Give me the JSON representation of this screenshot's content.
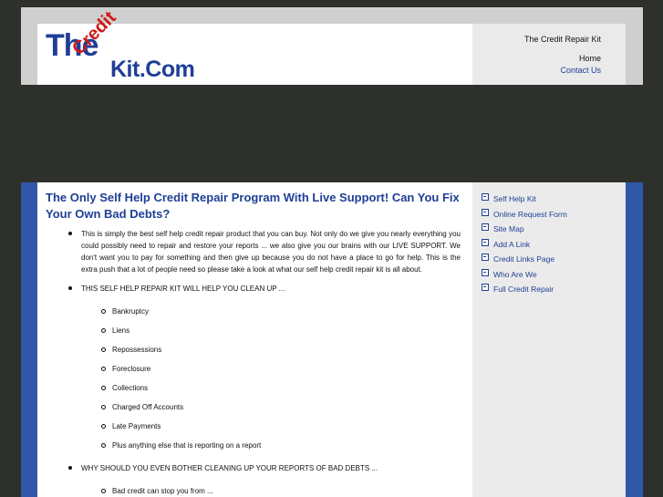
{
  "logo": {
    "the": "The",
    "credit": "Credit",
    "kit": "Kit.Com"
  },
  "header": {
    "site_name": "The Credit Repair Kit",
    "nav": {
      "home": "Home",
      "contact": "Contact Us"
    }
  },
  "main": {
    "title": "The Only Self Help Credit Repair Program With Live Support!  Can You Fix Your Own Bad Debts?",
    "bullets": {
      "intro": "This is simply the best self help credit repair product that you can buy.  Not only do we give you nearly everything you could possibly need to repair and restore your reports ... we also give you our brains with our LIVE SUPPORT.  We don't want you to pay for something and then give up because you do not have a place to go for help.  This is the extra push that a lot of people need so please take a look at what our self help credit repair kit is all about.",
      "cleanup_heading": "THIS SELF HELP REPAIR KIT WILL HELP YOU CLEAN UP ...",
      "cleanup_items": [
        "Bankruptcy",
        "Liens",
        "Repossessions",
        "Foreclosure",
        "Collections",
        "Charged Off Accounts",
        "Late Payments",
        "Plus anything else that is reporting on a report"
      ],
      "why_heading": "WHY SHOULD YOU EVEN BOTHER CLEANING UP YOUR REPORTS OF BAD DEBTS ...",
      "why_items": [
        "Bad credit can stop you from ..."
      ]
    }
  },
  "sidebar": {
    "links": [
      "Self Help Kit",
      "Online Request Form",
      "Site Map",
      "Add A Link",
      "Credit Links Page",
      "Who Are We",
      "Full Credit Repair"
    ]
  },
  "colors": {
    "brand_blue": "#1f3f96",
    "logo_red": "#d01818",
    "frame_blue": "#3158a8",
    "background": "#2e302c"
  }
}
